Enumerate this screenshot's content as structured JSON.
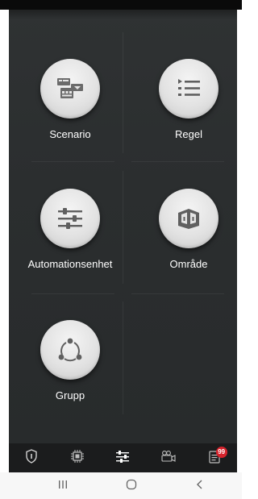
{
  "tiles": {
    "scenario": {
      "label": "Scenario",
      "icon": "scenario-icon"
    },
    "regel": {
      "label": "Regel",
      "icon": "list-icon"
    },
    "automation": {
      "label": "Automationsenhet",
      "icon": "sliders-icon"
    },
    "omrade": {
      "label": "Område",
      "icon": "area-icon"
    },
    "grupp": {
      "label": "Grupp",
      "icon": "group-icon"
    }
  },
  "tabbar": {
    "tabs": [
      {
        "icon": "shield-icon"
      },
      {
        "icon": "chip-icon"
      },
      {
        "icon": "sliders-icon",
        "active": true
      },
      {
        "icon": "camera-icon"
      },
      {
        "icon": "notifications-icon",
        "badge": "99"
      }
    ]
  },
  "colors": {
    "background": "#2c2f30",
    "tabbar": "#1b1c1d",
    "badge": "#d5232c",
    "label": "#ffffff"
  }
}
